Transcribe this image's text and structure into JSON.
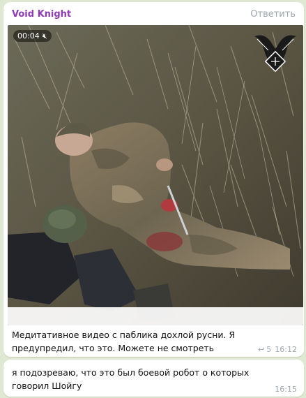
{
  "message1": {
    "sender": "Void Knight",
    "reply_label": "Ответить",
    "video": {
      "duration": "00:04",
      "mute_icon": "muted-speaker-icon",
      "watermark_icon": "winged-shield-emblem"
    },
    "caption": "Медитативное видео с паблика дохлой русни. Я предупредил, что это. Можете не смотреть",
    "views": "5",
    "time": "16:12",
    "forward_icon": "forward-arrow-icon"
  },
  "message2": {
    "text": "я подозреваю, что это был боевой робот о которых говорил Шойгу",
    "time": "16:15"
  },
  "colors": {
    "chat_background": "#dfe8d2",
    "bubble": "#ffffff",
    "sender_name": "#8e3bb5",
    "secondary_text": "#a0a7ad"
  }
}
